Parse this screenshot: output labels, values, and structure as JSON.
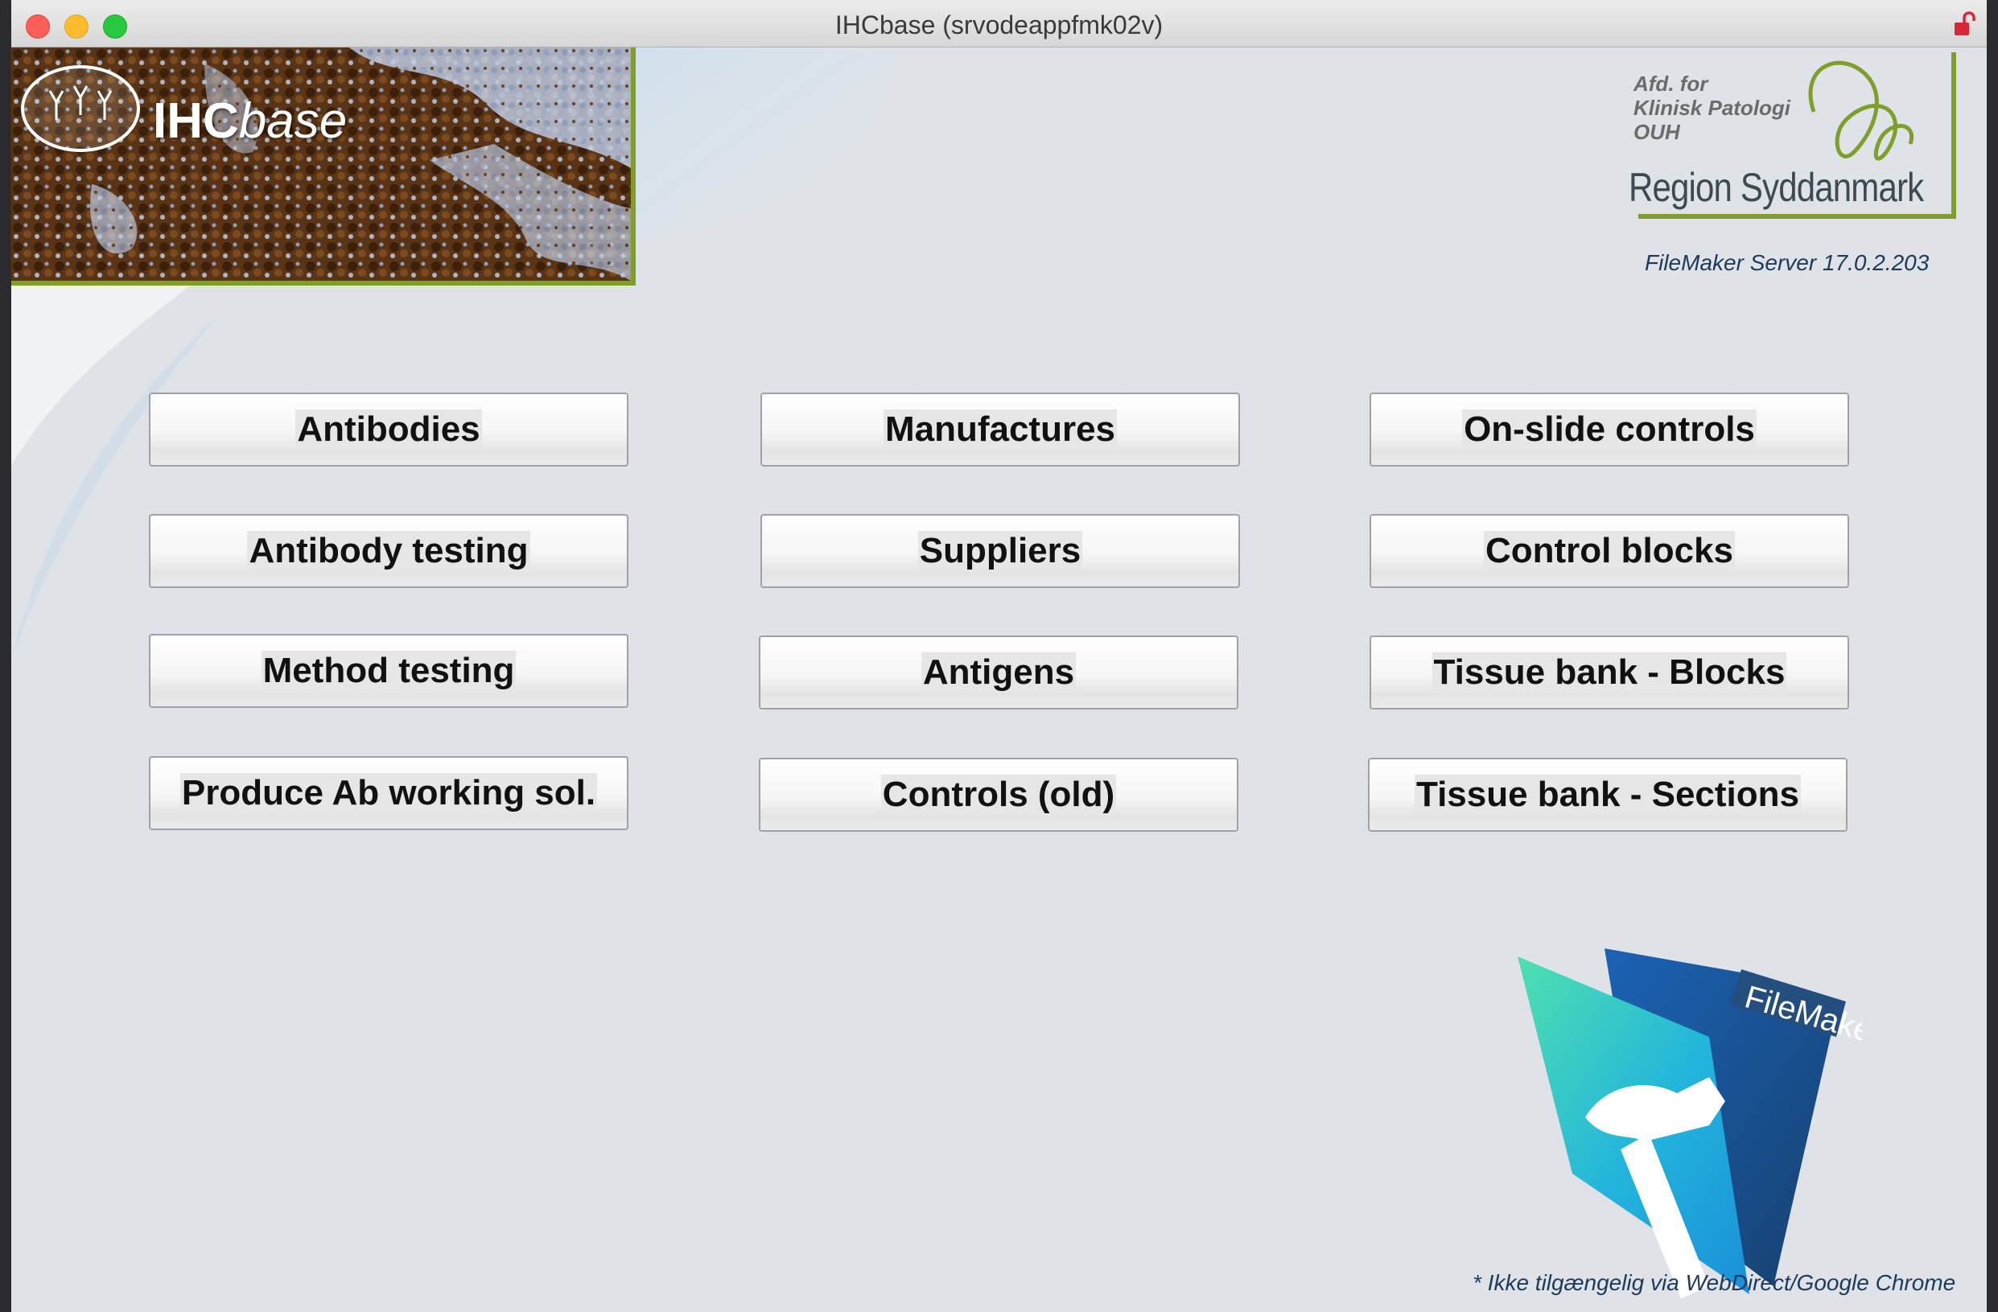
{
  "window": {
    "title": "IHCbase (srvodeappfmk02v)"
  },
  "header": {
    "brand_plain": "IHC",
    "brand_italic": "base",
    "dept_line1": "Afd. for",
    "dept_line2": "Klinisk Patologi",
    "dept_line3": "OUH",
    "region": "Region Syddanmark",
    "server_version": "FileMaker Server 17.0.2.203"
  },
  "buttons": {
    "antibodies": "Antibodies",
    "antibody_testing": "Antibody testing",
    "method_testing": "Method testing",
    "produce_ab": "Produce Ab working sol.",
    "manufactures": "Manufactures",
    "suppliers": "Suppliers",
    "antigens": "Antigens",
    "controls_old": "Controls (old)",
    "on_slide_controls": "On-slide controls",
    "control_blocks": "Control blocks",
    "tissue_blocks": "Tissue bank - Blocks",
    "tissue_sections": "Tissue bank - Sections"
  },
  "filemaker_logo_text": "FileMaker",
  "footnote": "* Ikke tilgængelig via WebDirect/Google Chrome",
  "colors": {
    "accent_green": "#7f9e2a",
    "background": "#dfe3e7",
    "text_dark_blue": "#1d3a5a"
  },
  "icons": [
    "window-close-icon",
    "window-minimize-icon",
    "window-maximize-icon",
    "unlock-icon",
    "ihc-antibody-logo-icon",
    "region-syddanmark-logo-icon",
    "filemaker-hammer-icon"
  ]
}
